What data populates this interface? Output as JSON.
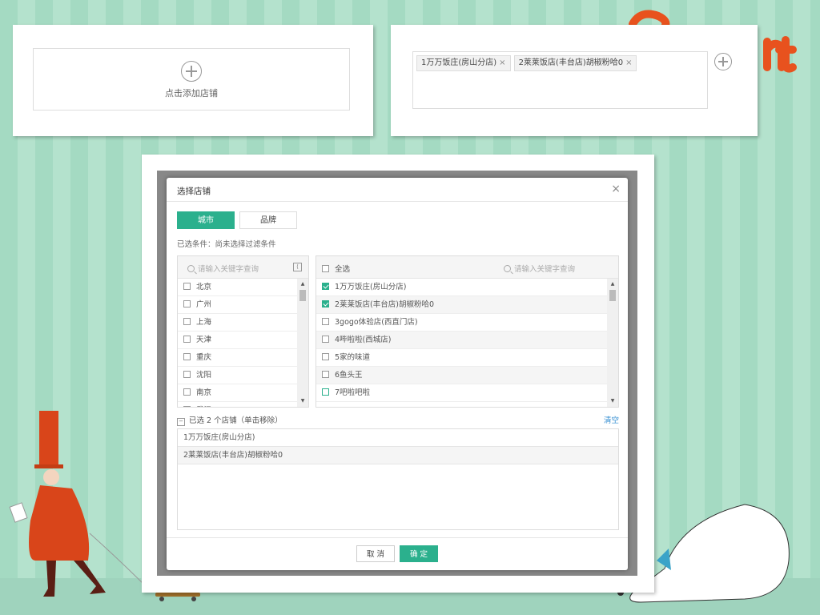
{
  "colors": {
    "accent": "#2bb08d",
    "link": "#2f8bd0",
    "background": "#a8dcc5",
    "mascot_orange": "#d9451a"
  },
  "left_card": {
    "add_label": "点击添加店铺",
    "icon": "plus-circle-icon"
  },
  "right_card": {
    "tags": [
      {
        "label": "1万万饭庄(房山分店)"
      },
      {
        "label": "2莱莱饭店(丰台店)胡椒粉哈0"
      }
    ],
    "tag_close": "×",
    "add_icon": "plus-circle-icon"
  },
  "dialog": {
    "title": "选择店铺",
    "close": "×",
    "tabs": [
      {
        "label": "城市",
        "active": true
      },
      {
        "label": "品牌",
        "active": false
      }
    ],
    "conditions": "已选条件：尚未选择过滤条件",
    "city_panel": {
      "search_placeholder": "请输入关键字查询",
      "collapse": "⟨",
      "items": [
        {
          "label": "北京",
          "checked": false
        },
        {
          "label": "广州",
          "checked": false
        },
        {
          "label": "上海",
          "checked": false
        },
        {
          "label": "天津",
          "checked": false
        },
        {
          "label": "重庆",
          "checked": false
        },
        {
          "label": "沈阳",
          "checked": false
        },
        {
          "label": "南京",
          "checked": false
        },
        {
          "label": "武汉",
          "checked": false
        }
      ]
    },
    "store_panel": {
      "select_all": "全选",
      "search_placeholder": "请输入关键字查询",
      "items": [
        {
          "label": "1万万饭庄(房山分店)",
          "checked": true
        },
        {
          "label": "2莱莱饭店(丰台店)胡椒粉哈0",
          "checked": true
        },
        {
          "label": "3gogo体验店(西直门店)",
          "checked": false
        },
        {
          "label": "4哔啦啦(西城店)",
          "checked": false
        },
        {
          "label": "5家的味道",
          "checked": false
        },
        {
          "label": "6鱼头王",
          "checked": false
        },
        {
          "label": "7吧啦吧啦",
          "checked": false
        }
      ]
    },
    "selected": {
      "header": "已选 2 个店铺（单击移除）",
      "toggle": "−",
      "clear": "清空",
      "items": [
        {
          "label": "1万万饭庄(房山分店)"
        },
        {
          "label": "2莱莱饭店(丰台店)胡椒粉哈0"
        }
      ]
    },
    "footer": {
      "cancel": "取 消",
      "ok": "确 定"
    }
  },
  "scroll_arrows": {
    "up": "▲",
    "down": "▼"
  }
}
